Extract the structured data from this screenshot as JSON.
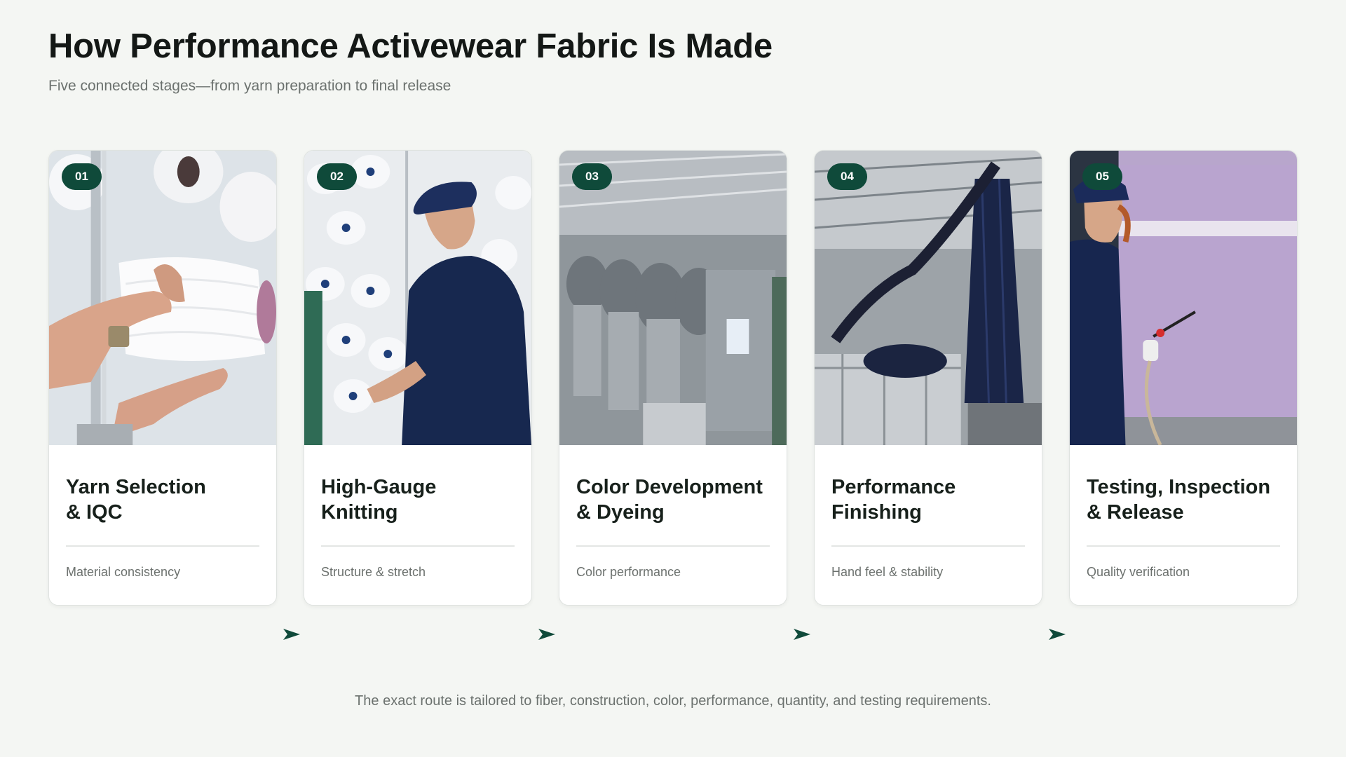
{
  "header": {
    "title": "How Performance Activewear Fabric Is Made",
    "subtitle": "Five connected stages—from yarn preparation to final release"
  },
  "stages": [
    {
      "number": "01",
      "title_line1": "Yarn Selection",
      "title_line2": "& IQC",
      "caption": "Material consistency",
      "photo": "hands holding white yarn cone"
    },
    {
      "number": "02",
      "title_line1": "High-Gauge",
      "title_line2": "Knitting",
      "caption": "Structure & stretch",
      "photo": "worker checking yarn creel"
    },
    {
      "number": "03",
      "title_line1": "Color Development",
      "title_line2": "& Dyeing",
      "caption": "Color performance",
      "photo": "stainless steel dyeing machines"
    },
    {
      "number": "04",
      "title_line1": "Performance",
      "title_line2": "Finishing",
      "caption": "Hand feel & stability",
      "photo": "navy fabric on finishing line"
    },
    {
      "number": "05",
      "title_line1": "Testing, Inspection",
      "title_line2": "& Release",
      "caption": "Quality verification",
      "photo": "inspector checking lavender fabric"
    }
  ],
  "footer": {
    "note": "The exact route is tailored to fiber, construction, color, performance, quantity, and testing requirements."
  },
  "colors": {
    "accent": "#0f4a3a",
    "background": "#f4f6f3",
    "card": "#ffffff"
  },
  "icons": {
    "flow_arrow": "arrow-right-icon"
  }
}
